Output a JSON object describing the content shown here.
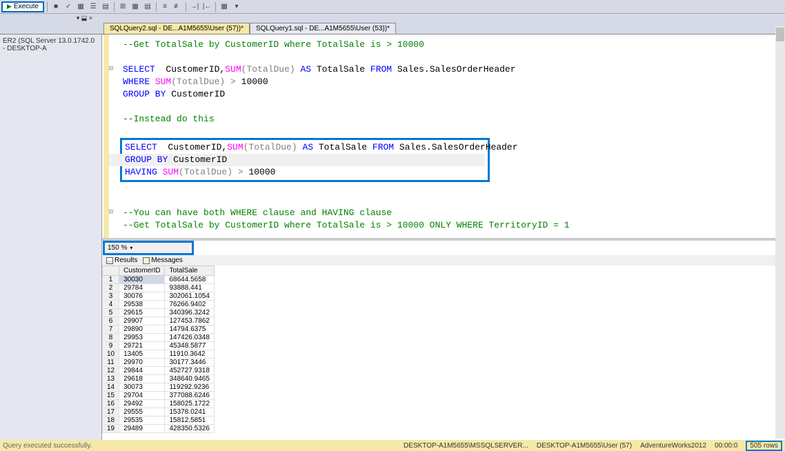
{
  "toolbar": {
    "execute_label": "Execute"
  },
  "tabs": {
    "active": "SQLQuery2.sql - DE...A1M5655\\User (57))*",
    "inactive": "SQLQuery1.sql - DE...A1M5655\\User (53))*",
    "close_marker": "▾ ⬓ ×"
  },
  "sidebar": {
    "server": "ER2 (SQL Server 13.0.1742.0 - DESKTOP-A"
  },
  "code": {
    "l1": "--Get TotalSale by CustomerID where TotalSale is > 10000",
    "l2a": "SELECT",
    "l2b": "  CustomerID,",
    "l2c": "SUM",
    "l2d": "(TotalDue)",
    "l2e": " AS ",
    "l2f": "TotalSale ",
    "l2g": "FROM",
    "l2h": " Sales.SalesOrderHeader",
    "l3a": "WHERE ",
    "l3b": "SUM",
    "l3c": "(TotalDue)",
    "l3d": " > ",
    "l3e": "10000",
    "l4a": "GROUP BY",
    "l4b": " CustomerID",
    "l5": "--Instead do this",
    "l6a": "SELECT",
    "l6b": "  CustomerID,",
    "l6c": "SUM",
    "l6d": "(TotalDue)",
    "l6e": " AS ",
    "l6f": "TotalSale ",
    "l6g": "FROM",
    "l6h": " Sales.SalesOrderHeader",
    "l7a": "GROUP BY",
    "l7b": " CustomerID",
    "l8a": "HAVING ",
    "l8b": "SUM",
    "l8c": "(TotalDue)",
    "l8d": " > ",
    "l8e": "10000",
    "l9": "--You can have both WHERE clause and HAVING clause",
    "l10": "--Get TotalSale by CustomerID where TotalSale is > 10000 ONLY WHERE TerritoryID = 1"
  },
  "zoom": "150 %",
  "results_tabs": {
    "results": "Results",
    "messages": "Messages"
  },
  "grid": {
    "columns": [
      "CustomerID",
      "TotalSale"
    ],
    "rows": [
      {
        "n": "1",
        "c": "30030",
        "t": "68644.5658"
      },
      {
        "n": "2",
        "c": "29784",
        "t": "93888.441"
      },
      {
        "n": "3",
        "c": "30076",
        "t": "302061.1054"
      },
      {
        "n": "4",
        "c": "29538",
        "t": "76266.9402"
      },
      {
        "n": "5",
        "c": "29615",
        "t": "340396.3242"
      },
      {
        "n": "6",
        "c": "29907",
        "t": "127453.7862"
      },
      {
        "n": "7",
        "c": "29890",
        "t": "14794.6375"
      },
      {
        "n": "8",
        "c": "29953",
        "t": "147426.0348"
      },
      {
        "n": "9",
        "c": "29721",
        "t": "45348.5877"
      },
      {
        "n": "10",
        "c": "13405",
        "t": "11910.3642"
      },
      {
        "n": "11",
        "c": "29970",
        "t": "30177.3446"
      },
      {
        "n": "12",
        "c": "29844",
        "t": "452727.9318"
      },
      {
        "n": "13",
        "c": "29618",
        "t": "348640.9465"
      },
      {
        "n": "14",
        "c": "30073",
        "t": "119292.9236"
      },
      {
        "n": "15",
        "c": "29704",
        "t": "377088.6246"
      },
      {
        "n": "16",
        "c": "29492",
        "t": "158025.1722"
      },
      {
        "n": "17",
        "c": "29555",
        "t": "15378.0241"
      },
      {
        "n": "18",
        "c": "29535",
        "t": "15812.5851"
      },
      {
        "n": "19",
        "c": "29489",
        "t": "428350.5326"
      }
    ]
  },
  "status": {
    "exec_msg": "Query executed successfully.",
    "server": "DESKTOP-A1M5655\\MSSQLSERVER...",
    "user": "DESKTOP-A1M5655\\User (57)",
    "db": "AdventureWorks2012",
    "time": "00:00:0",
    "rows": "505 rows"
  }
}
